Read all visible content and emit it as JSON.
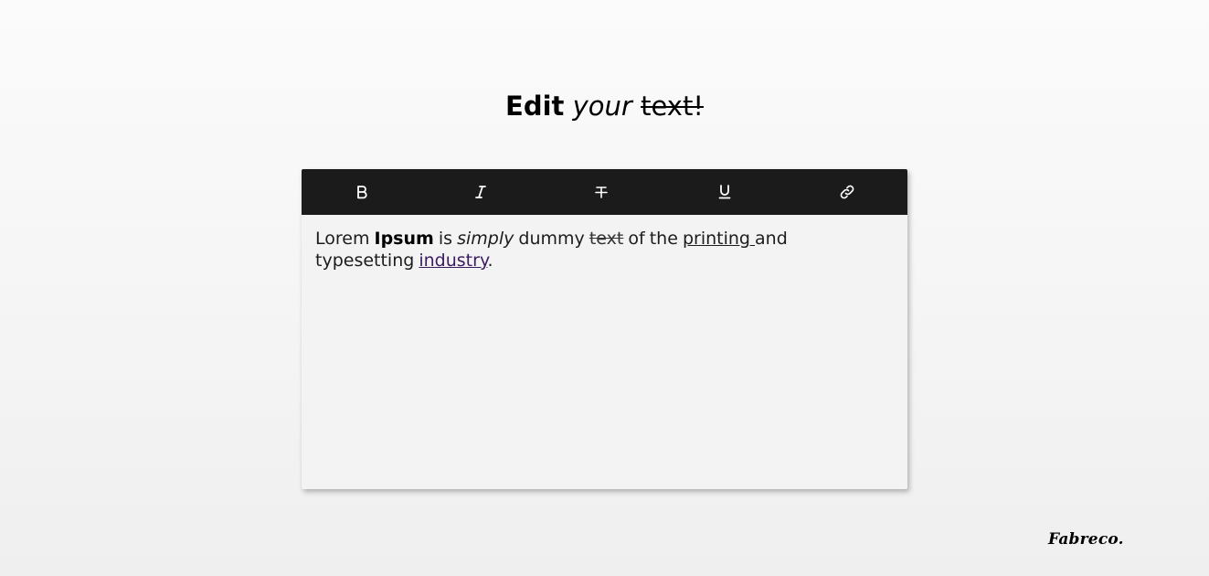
{
  "heading": {
    "word1": "Edit",
    "word2": "your",
    "word3": "text!"
  },
  "toolbar": {
    "buttons": [
      {
        "name": "bold",
        "icon": "bold-icon"
      },
      {
        "name": "italic",
        "icon": "italic-icon"
      },
      {
        "name": "strikethrough",
        "icon": "strikethrough-icon"
      },
      {
        "name": "underline",
        "icon": "underline-icon"
      },
      {
        "name": "link",
        "icon": "link-icon"
      }
    ]
  },
  "editor": {
    "content": {
      "t1": "Lorem ",
      "t2": "Ipsum",
      "t3": " is ",
      "t4": "simply",
      "t5": " dummy ",
      "t6": "text",
      "t7": " of the ",
      "t8": "printing ",
      "t9": "and typesetting ",
      "t10": "industry",
      "t11": "."
    }
  },
  "brand": {
    "logo": "Fabreco."
  },
  "colors": {
    "toolbar_bg": "#1b1b1b",
    "editor_bg": "#f3f3f3",
    "link": "#3b1b62"
  }
}
